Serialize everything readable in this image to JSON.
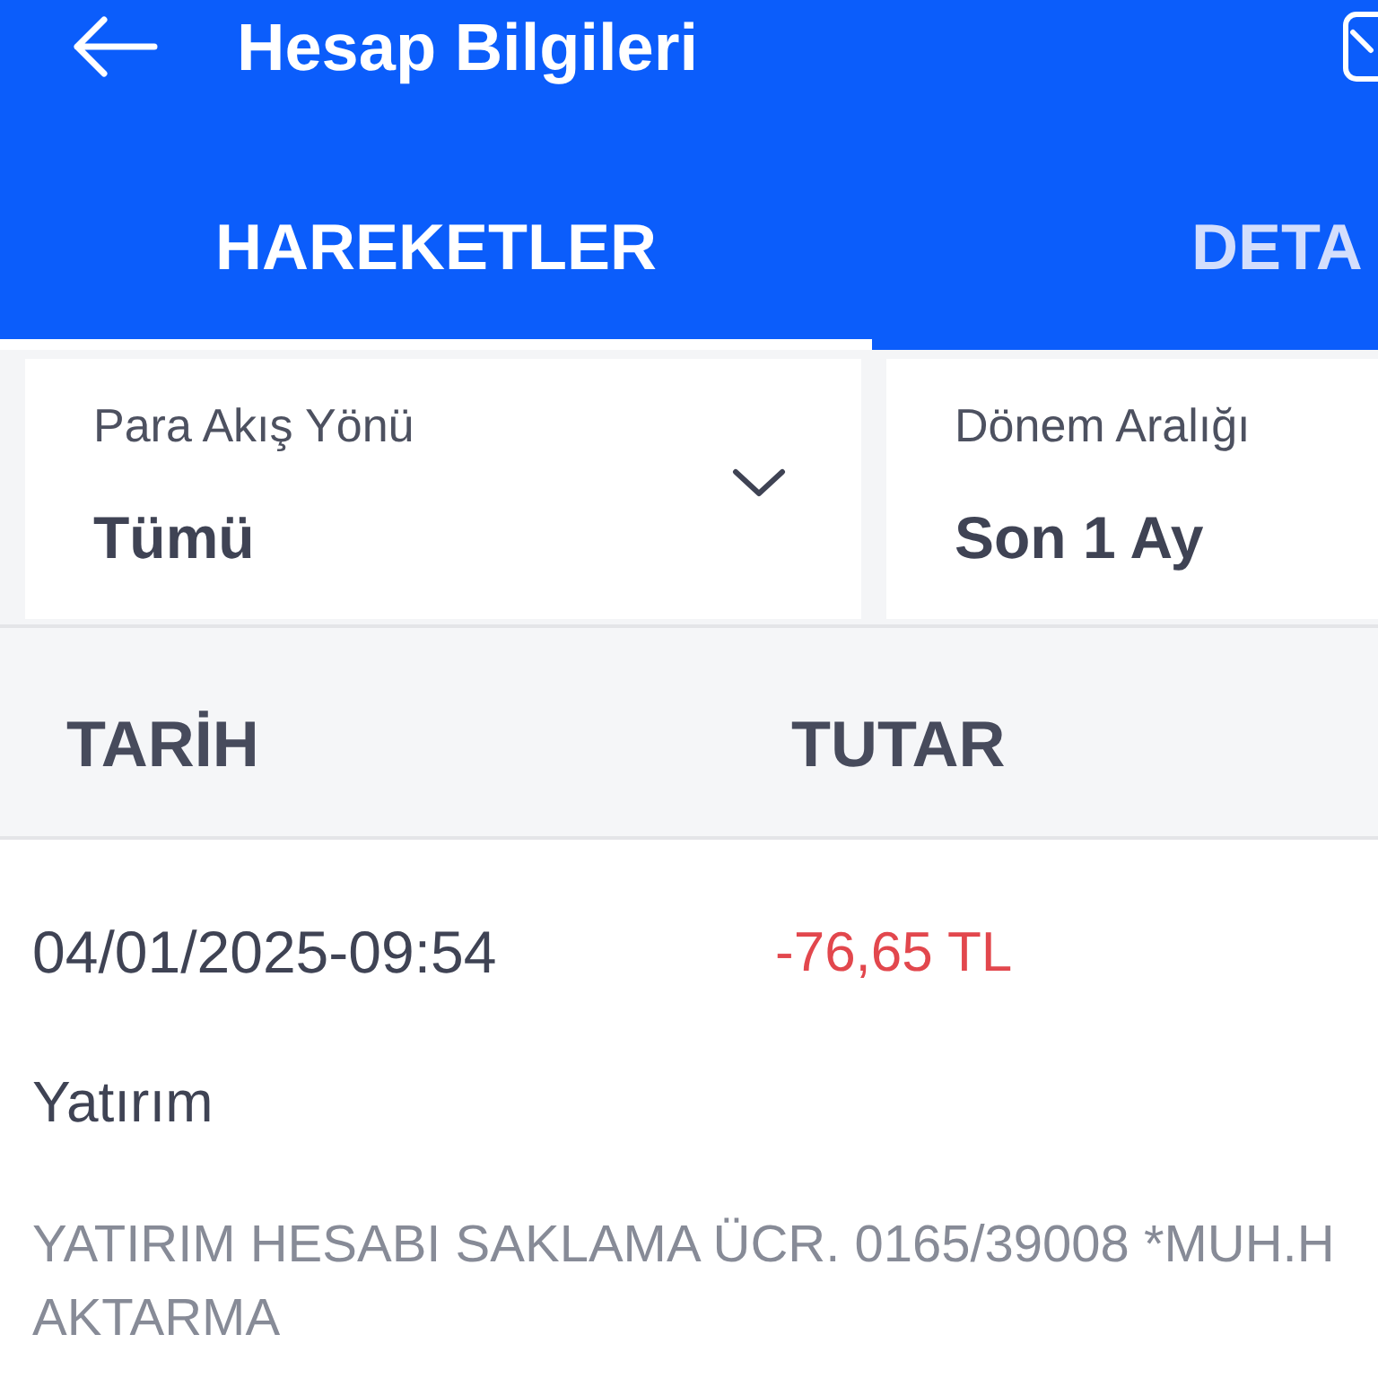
{
  "header": {
    "title": "Hesap Bilgileri"
  },
  "tabs": [
    {
      "label": "HAREKETLER",
      "selected": true
    },
    {
      "label": "DETA",
      "selected": false
    }
  ],
  "filters": [
    {
      "label": "Para Akış Yönü",
      "value": "Tümü",
      "chevron": true
    },
    {
      "label": "Dönem Aralığı",
      "value": "Son 1 Ay",
      "chevron": false
    }
  ],
  "table": {
    "columns": [
      "TARİH",
      "TUTAR"
    ],
    "rows": [
      {
        "date": "04/01/2025-09:54",
        "amount": "-76,65 TL",
        "kind": "debit",
        "category": "Yatırım",
        "description_lines": [
          "YATIRIM HESABI SAKLAMA ÜCR. 0165/39008 *MUH.H",
          "AKTARMA"
        ]
      }
    ]
  }
}
